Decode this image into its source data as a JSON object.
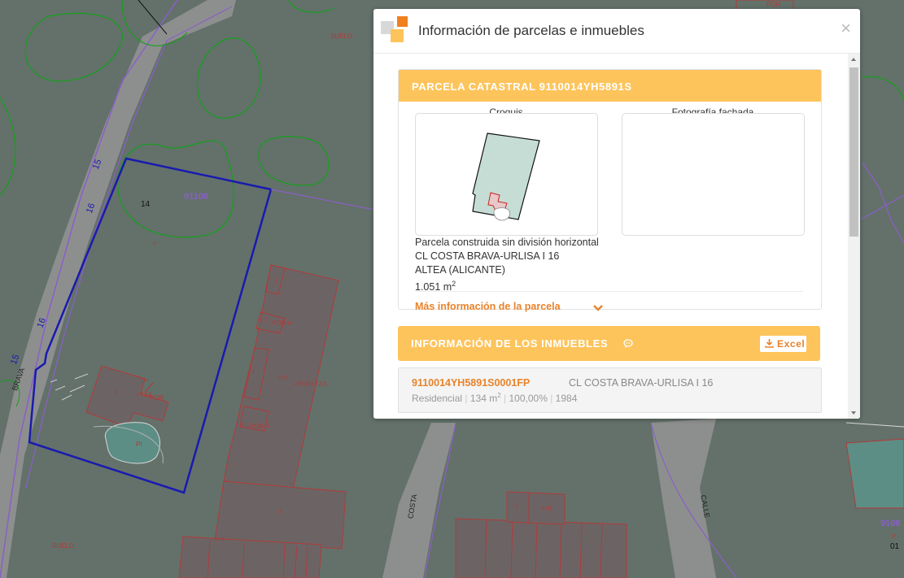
{
  "map": {
    "labels": {
      "suelo_top": "SUELO",
      "por_top": "POR",
      "num_15": "15",
      "num_16a": "16",
      "num_16b": "16",
      "num_15b": "15",
      "brava": "BRAVA",
      "parcel_id": "91100",
      "num_14": "14",
      "p_small": "P",
      "ii": "II",
      "tza": "+TZA",
      "por_a": "POR",
      "pi": "PI",
      "i_a": "I",
      "i_b": "I",
      "por_i_a": "-POR+I",
      "i_c": "I",
      "ii_b": "-I+II",
      "por_tza": "+POR+TZA",
      "i_d": "-I",
      "por_i_b": "-POR+I",
      "i_e": "I",
      "i_f": "-I",
      "ii_c": "-I+II",
      "suelo_bottom": "SUELO",
      "costa": "COSTA",
      "calle": "CALLE",
      "i_g": "-I",
      "i_h": "-I+II",
      "num_9108": "9108",
      "p_right": "P",
      "num_01": "01"
    }
  },
  "dialog": {
    "title": "Información de parcelas e inmuebles",
    "close": "×",
    "parcel": {
      "header": "PARCELA CATASTRAL 9110014YH5891S",
      "croquis_title": "Croquis",
      "foto_title": "Fotografía fachada",
      "desc_line1": "Parcela construida sin división horizontal",
      "desc_line2": "CL COSTA BRAVA-URLISA I 16",
      "desc_line3": "ALTEA (ALICANTE)",
      "area": "1.051 m",
      "area_sup": "2",
      "more_link": "Más información de la parcela"
    },
    "inmuebles": {
      "header": "INFORMACIÓN DE LOS INMUEBLES",
      "excel_label": "Excel",
      "rows": [
        {
          "ref": "9110014YH5891S0001FP",
          "address": "CL COSTA BRAVA-URLISA I 16",
          "use": "Residencial",
          "surface": "134 m",
          "surface_sup": "2",
          "percent": "100,00%",
          "year": "1984",
          "sep": "|"
        }
      ]
    }
  },
  "colors": {
    "map_bg": "#63716a",
    "road": "#8d8f8e",
    "parcel_blue": "#1a1ab0",
    "building_red": "#b13a3a",
    "contour_green": "#14a01a",
    "accent_orange": "#e8832b",
    "header_yellow": "#fdc45c"
  }
}
